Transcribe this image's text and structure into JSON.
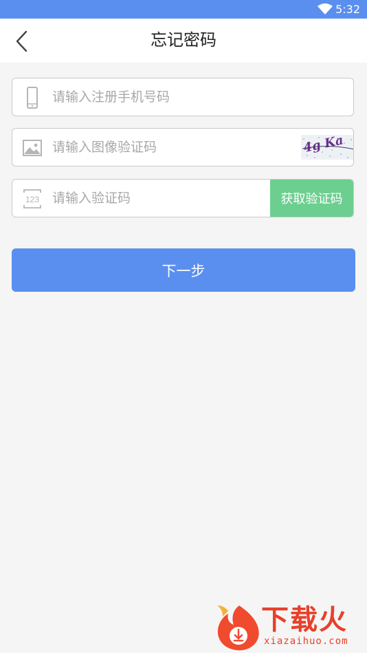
{
  "status_bar": {
    "time": "5:32"
  },
  "header": {
    "title": "忘记密码"
  },
  "form": {
    "phone": {
      "placeholder": "请输入注册手机号码",
      "value": ""
    },
    "image_code": {
      "placeholder": "请输入图像验证码",
      "value": "",
      "captcha_text": "4g Ka"
    },
    "sms_code": {
      "placeholder": "请输入验证码",
      "value": "",
      "icon_text": "123",
      "button_label": "获取验证码"
    }
  },
  "next_button_label": "下一步",
  "watermark": {
    "brand": "下载火",
    "domain": "xiazaihuo.com"
  },
  "colors": {
    "primary": "#5a8ff0",
    "green": "#6ccf8f",
    "brand_red": "#e8402a"
  }
}
